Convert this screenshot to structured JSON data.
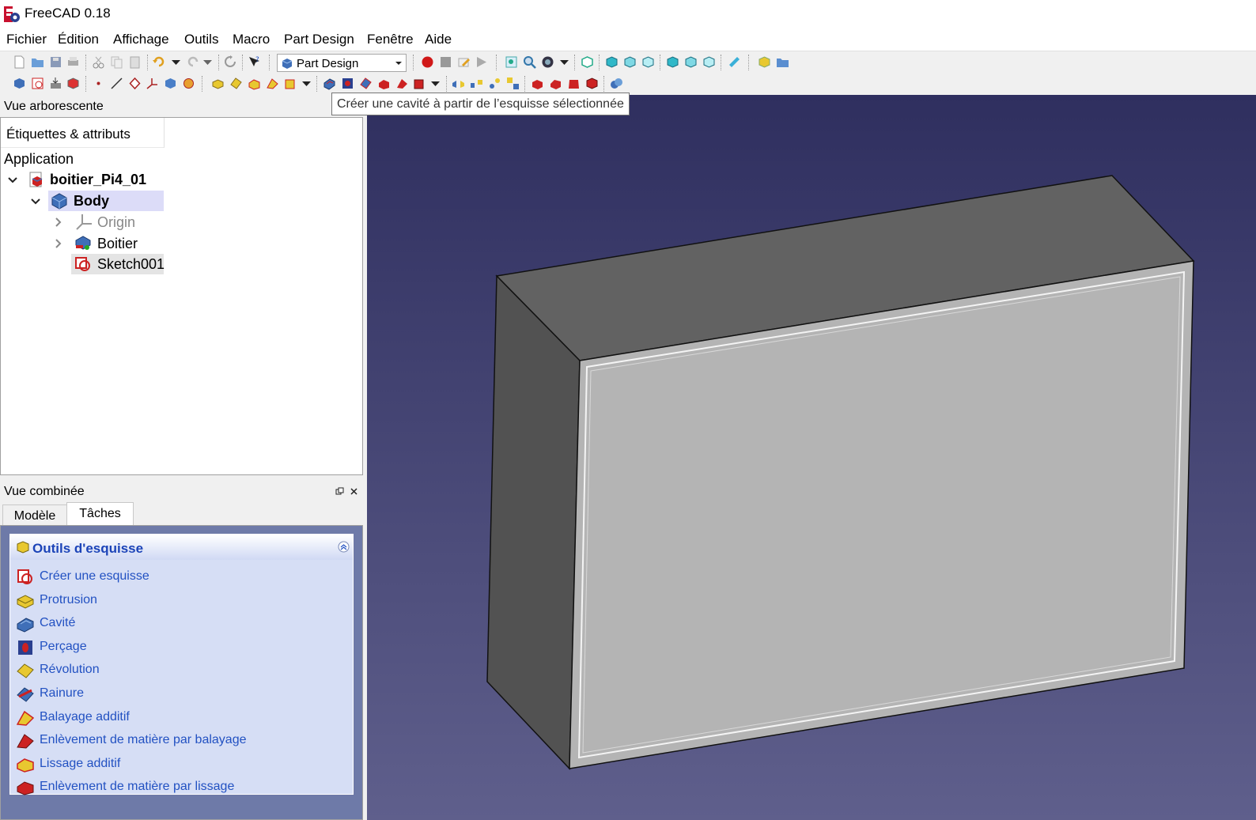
{
  "window": {
    "title": "FreeCAD 0.18"
  },
  "menu": {
    "items": [
      "Fichier",
      "Édition",
      "Affichage",
      "Outils",
      "Macro",
      "Part Design",
      "Fenêtre",
      "Aide"
    ]
  },
  "toolbar": {
    "workbench": "Part Design"
  },
  "tooltip": "Créer une cavité à partir de l’esquisse sélectionnée",
  "tree": {
    "header": "Vue arborescente",
    "column": "Étiquettes & attributs",
    "root": "Application",
    "document": "boitier_Pi4_01",
    "body": "Body",
    "origin": "Origin",
    "boitier": "Boitier",
    "sketch": "Sketch001"
  },
  "combo": {
    "title": "Vue combinée",
    "tabs": [
      "Modèle",
      "Tâches"
    ],
    "active_tab": "Tâches"
  },
  "tasks": {
    "title": "Outils d'esquisse",
    "items": [
      {
        "label": "Créer une esquisse",
        "icon": "sketch-icon"
      },
      {
        "label": "Protrusion",
        "icon": "pad-icon"
      },
      {
        "label": "Cavité",
        "icon": "pocket-icon"
      },
      {
        "label": "Perçage",
        "icon": "hole-icon"
      },
      {
        "label": "Révolution",
        "icon": "revolution-icon"
      },
      {
        "label": "Rainure",
        "icon": "groove-icon"
      },
      {
        "label": "Balayage additif",
        "icon": "additive-pipe-icon"
      },
      {
        "label": "Enlèvement de matière par balayage",
        "icon": "subtractive-pipe-icon"
      },
      {
        "label": "Lissage additif",
        "icon": "additive-loft-icon"
      },
      {
        "label": "Enlèvement de matière par lissage",
        "icon": "subtractive-loft-icon"
      }
    ]
  },
  "colors": {
    "accent": "#2251c2",
    "selection": "#dcdcf8",
    "viewport_top": "#2f2f5f",
    "viewport_bottom": "#5f5f8c"
  }
}
